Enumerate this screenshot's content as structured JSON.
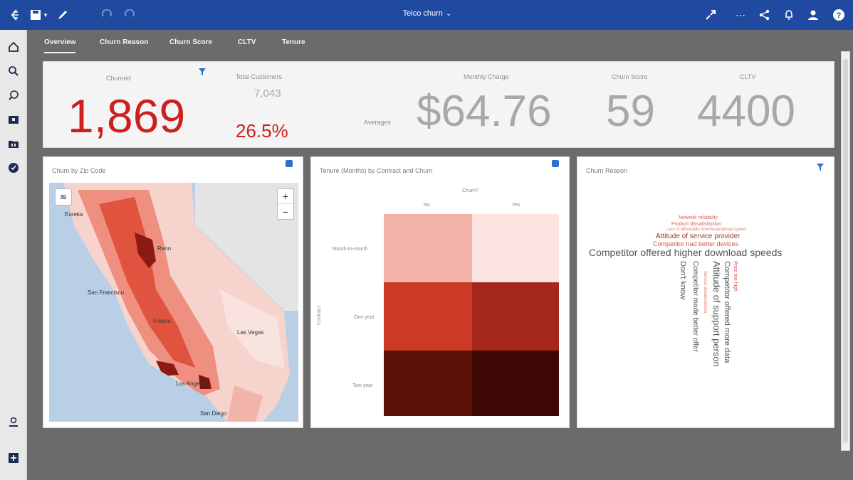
{
  "topbar": {
    "title": "Telco churn",
    "chevron": "⌄",
    "icons": [
      "back-icon",
      "save-icon",
      "save-dropdown-icon",
      "edit-icon",
      "undo-icon",
      "redo-icon",
      "fullscreen-icon",
      "more-icon",
      "share-icon",
      "notifications-icon",
      "user-icon",
      "help-icon"
    ]
  },
  "sidebar": {
    "icons": [
      "home-icon",
      "search-icon",
      "explore-icon",
      "team-content-icon",
      "my-content-icon",
      "recent-icon",
      "user-admin-icon",
      "new-icon"
    ]
  },
  "tabs": [
    "Overview",
    "Churn Reason",
    "Churn Score",
    "CLTV",
    "Tenure"
  ],
  "kpis": {
    "churned_label": "Churned",
    "churned_value": "1,869",
    "total_label": "Total Customers",
    "total_value": "7,043",
    "churn_rate": "26.5%",
    "averages_label": "Averages",
    "monthly_label": "Monthly Charge",
    "monthly_value": "$64.76",
    "score_label": "Churn Score",
    "score_value": "59",
    "cltv_label": "CLTV",
    "cltv_value": "4400",
    "accent_red": "#cc1f1f",
    "muted_gray": "#a8a8a8"
  },
  "map_card": {
    "title": "Churn by Zip Code",
    "zoom_in": "+",
    "zoom_out": "−",
    "cities": [
      "Eureka",
      "Reno",
      "San Francisco",
      "Fresno",
      "Las Vegas",
      "Los Angeles",
      "San Diego"
    ]
  },
  "heatmap_card": {
    "title": "Tenure (Months) by Contract and Churn",
    "column_header": "Churn?",
    "columns": [
      "No",
      "Yes"
    ],
    "rows": [
      "Month-to-month",
      "One year",
      "Two year"
    ],
    "y_axis_label": "Contract"
  },
  "wordcloud_card": {
    "title": "Churn Reason",
    "words": [
      "Network reliability",
      "Product dissatisfaction",
      "Lack of affordable download/upload speed",
      "Attitude of service provider",
      "Competitor had better devices",
      "Competitor offered higher download speeds",
      "Don't know",
      "Attitude of support person",
      "Competitor offered more data",
      "Competitor made better offer",
      "Price too high",
      "Service dissatisfaction"
    ]
  }
}
